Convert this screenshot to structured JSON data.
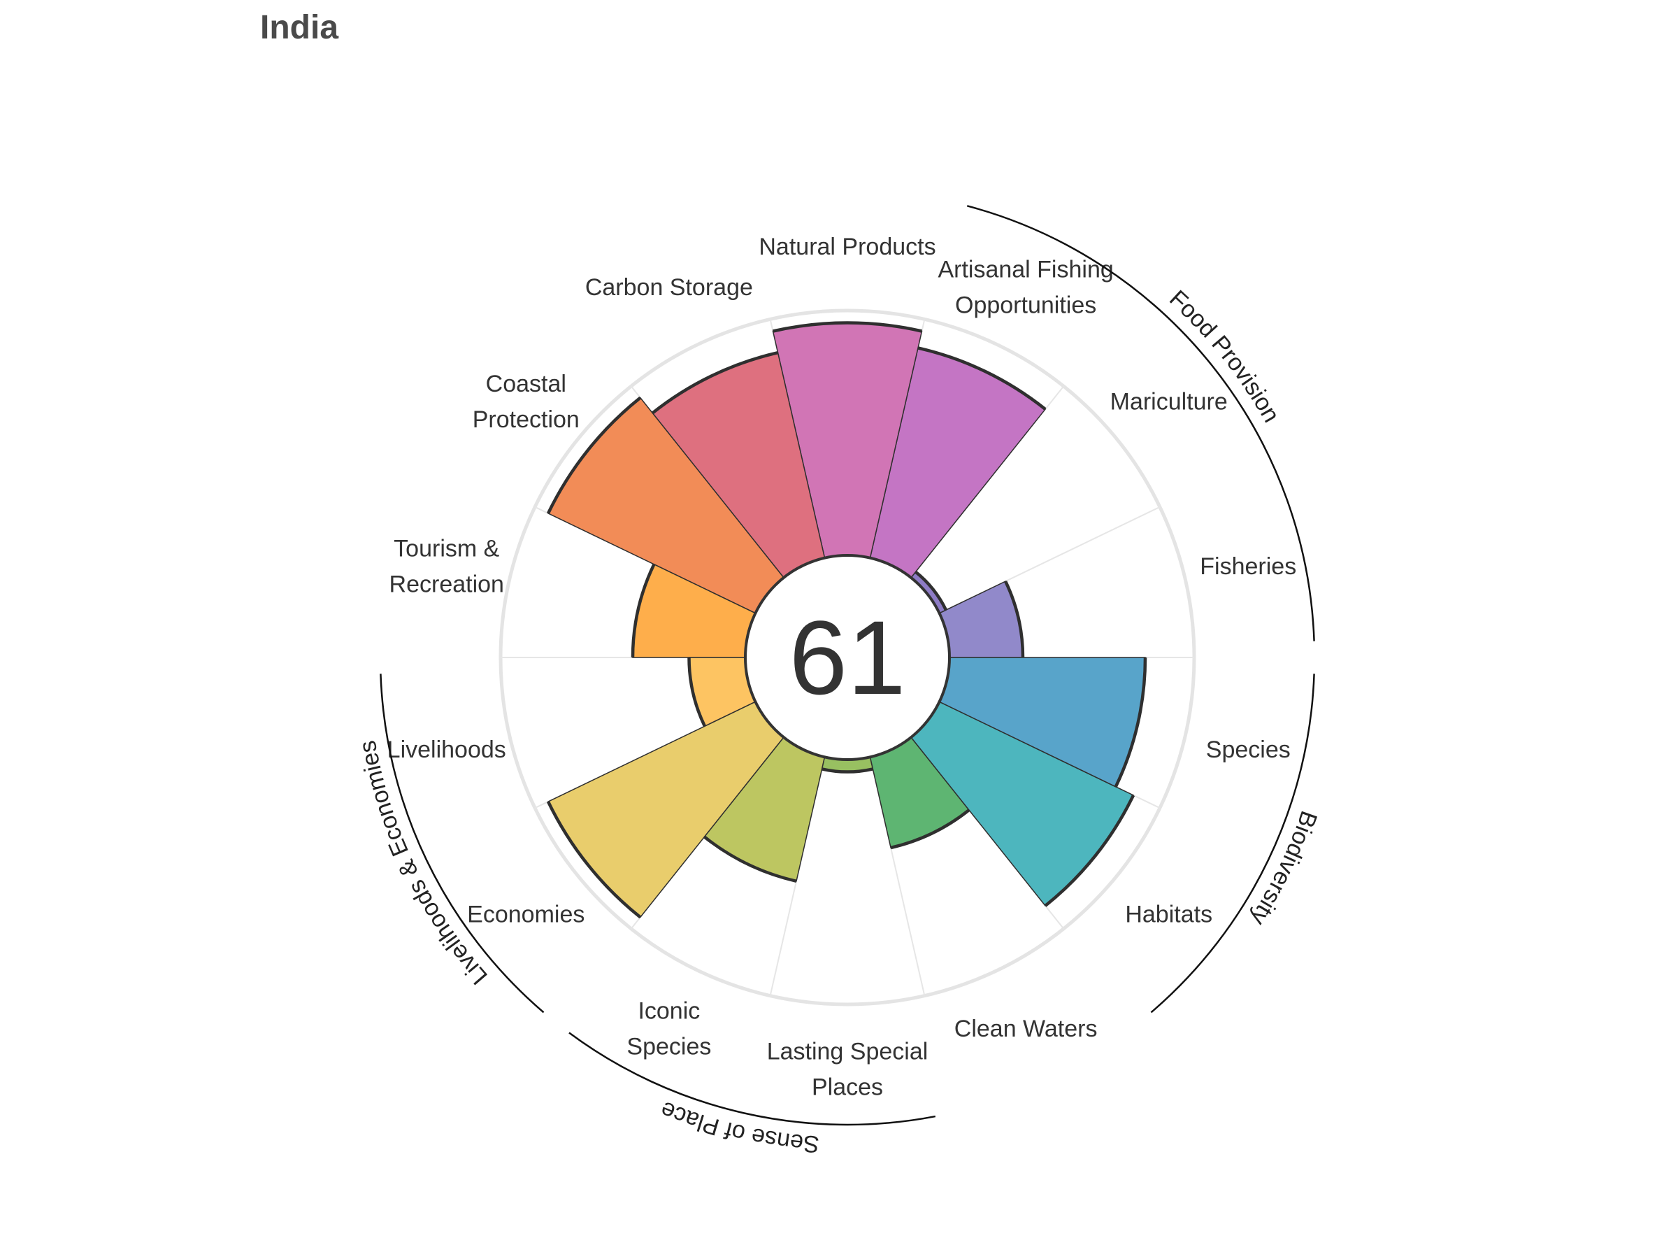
{
  "title": "India",
  "chart_data": {
    "type": "polar-bar",
    "title": "India",
    "overall_score": 61,
    "rmax": 100,
    "goals": [
      {
        "key": "fisheries",
        "label": [
          "Fisheries"
        ],
        "value": 30,
        "color": "#9189CA"
      },
      {
        "key": "mariculture",
        "label": [
          "Mariculture"
        ],
        "value": 3,
        "color": "#8E7CC6"
      },
      {
        "key": "artisanal",
        "label": [
          "Artisanal Fishing",
          "Opportunities"
        ],
        "value": 88,
        "color": "#C475C4"
      },
      {
        "key": "natural_products",
        "label": [
          "Natural Products"
        ],
        "value": 95,
        "color": "#D175B5"
      },
      {
        "key": "carbon",
        "label": [
          "Carbon Storage"
        ],
        "value": 86,
        "color": "#DE707F"
      },
      {
        "key": "coastal",
        "label": [
          "Coastal",
          "Protection"
        ],
        "value": 94,
        "color": "#F28C57"
      },
      {
        "key": "tourism",
        "label": [
          "Tourism &",
          "Recreation"
        ],
        "value": 46,
        "color": "#FEAE4B"
      },
      {
        "key": "livelihoods",
        "label": [
          "Livelihoods"
        ],
        "value": 23,
        "color": "#FDC462"
      },
      {
        "key": "economies",
        "label": [
          "Economies"
        ],
        "value": 94,
        "color": "#E9CD6C"
      },
      {
        "key": "iconic",
        "label": [
          "Iconic",
          "Species"
        ],
        "value": 52,
        "color": "#BDC661"
      },
      {
        "key": "lasting",
        "label": [
          "Lasting Special",
          "Places"
        ],
        "value": 5,
        "color": "#98C061"
      },
      {
        "key": "clean_waters",
        "label": [
          "Clean Waters"
        ],
        "value": 38,
        "color": "#5EB572"
      },
      {
        "key": "habitats",
        "label": [
          "Habitats"
        ],
        "value": 88,
        "color": "#4DB6BE"
      },
      {
        "key": "species",
        "label": [
          "Species"
        ],
        "value": 80,
        "color": "#58A4CA"
      }
    ],
    "groups": [
      {
        "label": "Food Provision"
      },
      {
        "label": "Biodiversity"
      },
      {
        "label": "Sense of Place"
      },
      {
        "label": "Livelihoods & Economies"
      }
    ]
  }
}
